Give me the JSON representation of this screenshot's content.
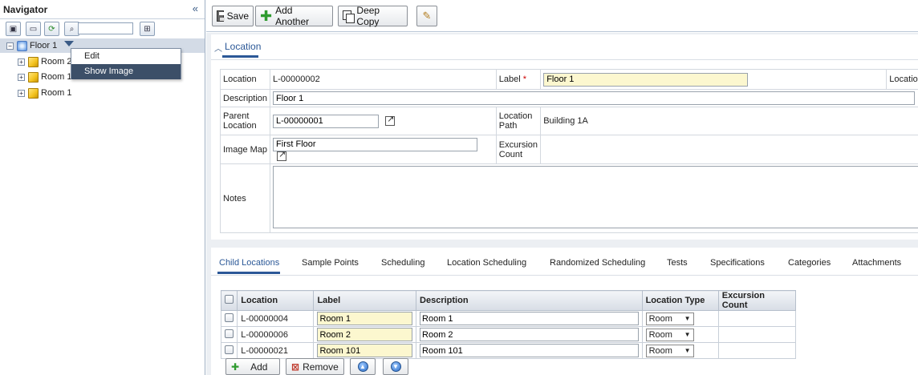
{
  "navigator": {
    "title": "Navigator",
    "collapse_glyph": "«",
    "search_value": "",
    "tree": {
      "root": {
        "label": "Floor 1",
        "expander": "⊟"
      },
      "children": [
        {
          "label": "Room 2",
          "expander": "+"
        },
        {
          "label": "Room 101",
          "expander": "+"
        },
        {
          "label": "Room 1",
          "expander": "+"
        }
      ]
    },
    "context_menu": {
      "items": [
        {
          "label": "Edit",
          "active": false
        },
        {
          "label": "Show Image",
          "active": true
        }
      ]
    }
  },
  "toolbar": {
    "save_label": "Save",
    "add_another_label": "Add Another",
    "deep_copy_label": "Deep Copy"
  },
  "location": {
    "section_title": "Location",
    "location_label": "Location",
    "location_value": "L-00000002",
    "label_label": "Label",
    "label_required": "*",
    "label_value": "Floor 1",
    "location_right_label": "Location",
    "description_label": "Description",
    "description_value": "Floor 1",
    "parent_location_label": "Parent Location",
    "parent_location_value": "L-00000001",
    "location_path_label": "Location Path",
    "location_path_value": "Building 1A",
    "image_map_label": "Image Map",
    "image_map_value": "First Floor",
    "excursion_count_label": "Excursion Count",
    "excursion_count_value": "",
    "notes_label": "Notes",
    "notes_value": ""
  },
  "child_tabs": [
    {
      "label": "Child Locations",
      "active": true
    },
    {
      "label": "Sample Points"
    },
    {
      "label": "Scheduling"
    },
    {
      "label": "Location Scheduling"
    },
    {
      "label": "Randomized Scheduling"
    },
    {
      "label": "Tests"
    },
    {
      "label": "Specifications"
    },
    {
      "label": "Categories"
    },
    {
      "label": "Attachments"
    }
  ],
  "child_grid": {
    "columns": [
      "Location",
      "Label",
      "Description",
      "Location Type",
      "Excursion Count"
    ],
    "rows": [
      {
        "location": "L-00000004",
        "label": "Room 1",
        "description": "Room 1",
        "type": "Room",
        "excursion": ""
      },
      {
        "location": "L-00000006",
        "label": "Room 2",
        "description": "Room 2",
        "type": "Room",
        "excursion": ""
      },
      {
        "location": "L-00000021",
        "label": "Room 101",
        "description": "Room 101",
        "type": "Room",
        "excursion": ""
      }
    ],
    "add_label": "Add",
    "remove_label": "Remove"
  },
  "colors": {
    "accent": "#2b5897",
    "selected_row": "#d3dbe6",
    "required_field": "#fcf7cf",
    "menu_active": "#3c4f68"
  }
}
